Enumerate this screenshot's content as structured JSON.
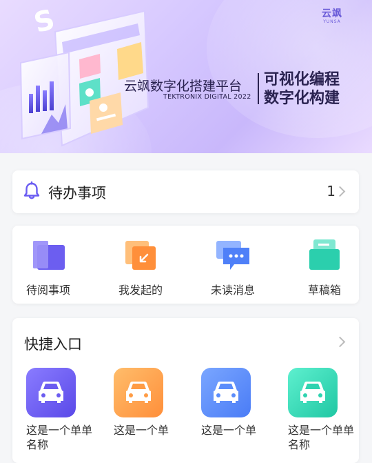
{
  "banner": {
    "logo_cn": "云飒",
    "logo_en": "YUNSA",
    "title": "云飒数字化搭建平台",
    "subtitle": "TEKTRONIX DIGITAL   2022",
    "slogan_line1": "可视化编程",
    "slogan_line2": "数字化构建"
  },
  "todo": {
    "label": "待办事项",
    "count": "1",
    "icon": "bell-icon"
  },
  "quick_actions": [
    {
      "label": "待阅事项",
      "icon": "folder-icon",
      "color": "#7a6cf0"
    },
    {
      "label": "我发起的",
      "icon": "arrow-send-icon",
      "color": "#ff9a4a"
    },
    {
      "label": "未读消息",
      "icon": "chat-bubble-icon",
      "color": "#5b8dfb"
    },
    {
      "label": "草稿箱",
      "icon": "draft-box-icon",
      "color": "#2fd3b0"
    }
  ],
  "shortcuts": {
    "title": "快捷入口",
    "items": [
      {
        "label": "这是一个单单名称",
        "icon": "car-icon",
        "color": "#6b5cf0"
      },
      {
        "label": "这是一个单",
        "icon": "car-icon",
        "color": "#ffa24c"
      },
      {
        "label": "这是一个单",
        "icon": "car-icon",
        "color": "#5b8dfb"
      },
      {
        "label": "这是一个单单名称",
        "icon": "car-icon",
        "color": "#2fd3b0"
      }
    ]
  }
}
